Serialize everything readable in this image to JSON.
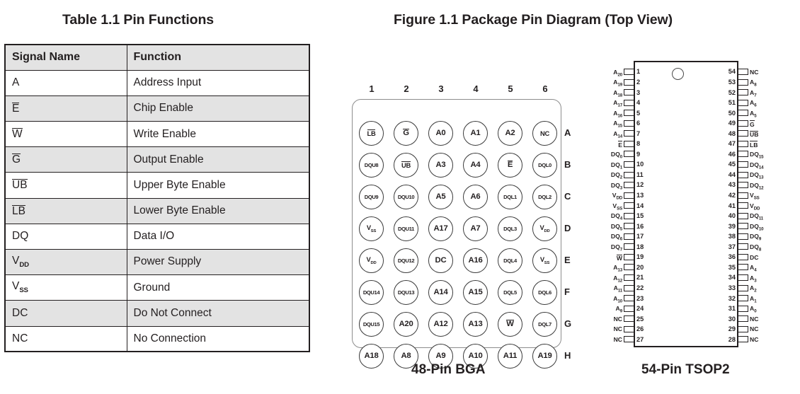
{
  "table": {
    "heading": "Table 1.1  Pin Functions",
    "columns": [
      "Signal Name",
      "Function"
    ],
    "rows": [
      {
        "signal": "A",
        "overline": false,
        "function": "Address Input"
      },
      {
        "signal": "E",
        "overline": true,
        "function": "Chip Enable"
      },
      {
        "signal": "W",
        "overline": true,
        "function": "Write Enable"
      },
      {
        "signal": "G",
        "overline": true,
        "function": "Output Enable"
      },
      {
        "signal": "UB",
        "overline": true,
        "function": "Upper Byte Enable"
      },
      {
        "signal": "LB",
        "overline": true,
        "function": "Lower Byte Enable"
      },
      {
        "signal": "DQ",
        "overline": false,
        "function": "Data I/O"
      },
      {
        "signal": "V",
        "subscript": "DD",
        "overline": false,
        "function": "Power Supply"
      },
      {
        "signal": "V",
        "subscript": "SS",
        "overline": false,
        "function": "Ground"
      },
      {
        "signal": "DC",
        "overline": false,
        "function": "Do Not Connect"
      },
      {
        "signal": "NC",
        "overline": false,
        "function": "No Connection"
      }
    ]
  },
  "figure": {
    "heading": "Figure 1.1  Package Pin Diagram (Top View)"
  },
  "bga": {
    "caption": "48-Pin BGA",
    "columns": [
      "1",
      "2",
      "3",
      "4",
      "5",
      "6"
    ],
    "rows": [
      "A",
      "B",
      "C",
      "D",
      "E",
      "F",
      "G",
      "H"
    ],
    "balls": [
      [
        {
          "t": "LB",
          "o": true,
          "s": "m"
        },
        {
          "t": "G",
          "o": true,
          "s": "l"
        },
        {
          "t": "A0",
          "o": false,
          "s": "l"
        },
        {
          "t": "A1",
          "o": false,
          "s": "l"
        },
        {
          "t": "A2",
          "o": false,
          "s": "l"
        },
        {
          "t": "NC",
          "o": false,
          "s": "m"
        }
      ],
      [
        {
          "t": "DQU8",
          "o": false,
          "s": "s"
        },
        {
          "t": "UB",
          "o": true,
          "s": "m"
        },
        {
          "t": "A3",
          "o": false,
          "s": "l"
        },
        {
          "t": "A4",
          "o": false,
          "s": "l"
        },
        {
          "t": "E",
          "o": true,
          "s": "l"
        },
        {
          "t": "DQL0",
          "o": false,
          "s": "s"
        }
      ],
      [
        {
          "t": "DQU9",
          "o": false,
          "s": "s"
        },
        {
          "t": "DQU10",
          "o": false,
          "s": "s"
        },
        {
          "t": "A5",
          "o": false,
          "s": "l"
        },
        {
          "t": "A6",
          "o": false,
          "s": "l"
        },
        {
          "t": "DQL1",
          "o": false,
          "s": "s"
        },
        {
          "t": "DQL2",
          "o": false,
          "s": "s"
        }
      ],
      [
        {
          "t": "VSS",
          "o": false,
          "s": "m",
          "sub": "SS",
          "base": "V"
        },
        {
          "t": "DQU11",
          "o": false,
          "s": "s"
        },
        {
          "t": "A17",
          "o": false,
          "s": "l"
        },
        {
          "t": "A7",
          "o": false,
          "s": "l"
        },
        {
          "t": "DQL3",
          "o": false,
          "s": "s"
        },
        {
          "t": "VDD",
          "o": false,
          "s": "m",
          "sub": "DD",
          "base": "V"
        }
      ],
      [
        {
          "t": "VDD",
          "o": false,
          "s": "m",
          "sub": "DD",
          "base": "V"
        },
        {
          "t": "DQU12",
          "o": false,
          "s": "s"
        },
        {
          "t": "DC",
          "o": false,
          "s": "l"
        },
        {
          "t": "A16",
          "o": false,
          "s": "l"
        },
        {
          "t": "DQL4",
          "o": false,
          "s": "s"
        },
        {
          "t": "VSS",
          "o": false,
          "s": "m",
          "sub": "SS",
          "base": "V"
        }
      ],
      [
        {
          "t": "DQU14",
          "o": false,
          "s": "s"
        },
        {
          "t": "DQU13",
          "o": false,
          "s": "s"
        },
        {
          "t": "A14",
          "o": false,
          "s": "l"
        },
        {
          "t": "A15",
          "o": false,
          "s": "l"
        },
        {
          "t": "DQL5",
          "o": false,
          "s": "s"
        },
        {
          "t": "DQL6",
          "o": false,
          "s": "s"
        }
      ],
      [
        {
          "t": "DQU15",
          "o": false,
          "s": "s"
        },
        {
          "t": "A20",
          "o": false,
          "s": "l"
        },
        {
          "t": "A12",
          "o": false,
          "s": "l"
        },
        {
          "t": "A13",
          "o": false,
          "s": "l"
        },
        {
          "t": "W",
          "o": true,
          "s": "l"
        },
        {
          "t": "DQL7",
          "o": false,
          "s": "s"
        }
      ],
      [
        {
          "t": "A18",
          "o": false,
          "s": "l"
        },
        {
          "t": "A8",
          "o": false,
          "s": "l"
        },
        {
          "t": "A9",
          "o": false,
          "s": "l"
        },
        {
          "t": "A10",
          "o": false,
          "s": "l"
        },
        {
          "t": "A11",
          "o": false,
          "s": "l"
        },
        {
          "t": "A19",
          "o": false,
          "s": "l"
        }
      ]
    ]
  },
  "tsop": {
    "caption": "54-Pin TSOP2",
    "left_pins": [
      {
        "num": "1",
        "base": "A",
        "sub": "20",
        "overline": false
      },
      {
        "num": "2",
        "base": "A",
        "sub": "19",
        "overline": false
      },
      {
        "num": "3",
        "base": "A",
        "sub": "18",
        "overline": false
      },
      {
        "num": "4",
        "base": "A",
        "sub": "17",
        "overline": false
      },
      {
        "num": "5",
        "base": "A",
        "sub": "16",
        "overline": false
      },
      {
        "num": "6",
        "base": "A",
        "sub": "15",
        "overline": false
      },
      {
        "num": "7",
        "base": "A",
        "sub": "14",
        "overline": false
      },
      {
        "num": "8",
        "base": "E",
        "sub": "",
        "overline": true
      },
      {
        "num": "9",
        "base": "DQ",
        "sub": "0",
        "overline": false
      },
      {
        "num": "10",
        "base": "DQ",
        "sub": "1",
        "overline": false
      },
      {
        "num": "11",
        "base": "DQ",
        "sub": "2",
        "overline": false
      },
      {
        "num": "12",
        "base": "DQ",
        "sub": "3",
        "overline": false
      },
      {
        "num": "13",
        "base": "V",
        "sub": "DD",
        "overline": false
      },
      {
        "num": "14",
        "base": "V",
        "sub": "SS",
        "overline": false
      },
      {
        "num": "15",
        "base": "DQ",
        "sub": "4",
        "overline": false
      },
      {
        "num": "16",
        "base": "DQ",
        "sub": "5",
        "overline": false
      },
      {
        "num": "17",
        "base": "DQ",
        "sub": "6",
        "overline": false
      },
      {
        "num": "18",
        "base": "DQ",
        "sub": "7",
        "overline": false
      },
      {
        "num": "19",
        "base": "W",
        "sub": "",
        "overline": true
      },
      {
        "num": "20",
        "base": "A",
        "sub": "13",
        "overline": false
      },
      {
        "num": "21",
        "base": "A",
        "sub": "12",
        "overline": false
      },
      {
        "num": "22",
        "base": "A",
        "sub": "11",
        "overline": false
      },
      {
        "num": "23",
        "base": "A",
        "sub": "10",
        "overline": false
      },
      {
        "num": "24",
        "base": "A",
        "sub": "9",
        "overline": false
      },
      {
        "num": "25",
        "base": "NC",
        "sub": "",
        "overline": false
      },
      {
        "num": "26",
        "base": "NC",
        "sub": "",
        "overline": false
      },
      {
        "num": "27",
        "base": "NC",
        "sub": "",
        "overline": false
      }
    ],
    "right_pins": [
      {
        "num": "54",
        "base": "NC",
        "sub": "",
        "overline": false
      },
      {
        "num": "53",
        "base": "A",
        "sub": "8",
        "overline": false
      },
      {
        "num": "52",
        "base": "A",
        "sub": "7",
        "overline": false
      },
      {
        "num": "51",
        "base": "A",
        "sub": "6",
        "overline": false
      },
      {
        "num": "50",
        "base": "A",
        "sub": "5",
        "overline": false
      },
      {
        "num": "49",
        "base": "G",
        "sub": "",
        "overline": true
      },
      {
        "num": "48",
        "base": "UB",
        "sub": "",
        "overline": true
      },
      {
        "num": "47",
        "base": "LB",
        "sub": "",
        "overline": true
      },
      {
        "num": "46",
        "base": "DQ",
        "sub": "15",
        "overline": false
      },
      {
        "num": "45",
        "base": "DQ",
        "sub": "14",
        "overline": false
      },
      {
        "num": "44",
        "base": "DQ",
        "sub": "13",
        "overline": false
      },
      {
        "num": "43",
        "base": "DQ",
        "sub": "12",
        "overline": false
      },
      {
        "num": "42",
        "base": "V",
        "sub": "SS",
        "overline": false
      },
      {
        "num": "41",
        "base": "V",
        "sub": "DD",
        "overline": false
      },
      {
        "num": "40",
        "base": "DQ",
        "sub": "11",
        "overline": false
      },
      {
        "num": "39",
        "base": "DQ",
        "sub": "10",
        "overline": false
      },
      {
        "num": "38",
        "base": "DQ",
        "sub": "9",
        "overline": false
      },
      {
        "num": "37",
        "base": "DQ",
        "sub": "8",
        "overline": false
      },
      {
        "num": "36",
        "base": "DC",
        "sub": "",
        "overline": false
      },
      {
        "num": "35",
        "base": "A",
        "sub": "4",
        "overline": false
      },
      {
        "num": "34",
        "base": "A",
        "sub": "3",
        "overline": false
      },
      {
        "num": "33",
        "base": "A",
        "sub": "2",
        "overline": false
      },
      {
        "num": "32",
        "base": "A",
        "sub": "1",
        "overline": false
      },
      {
        "num": "31",
        "base": "A",
        "sub": "0",
        "overline": false
      },
      {
        "num": "30",
        "base": "NC",
        "sub": "",
        "overline": false
      },
      {
        "num": "29",
        "base": "NC",
        "sub": "",
        "overline": false
      },
      {
        "num": "28",
        "base": "NC",
        "sub": "",
        "overline": false
      }
    ]
  }
}
